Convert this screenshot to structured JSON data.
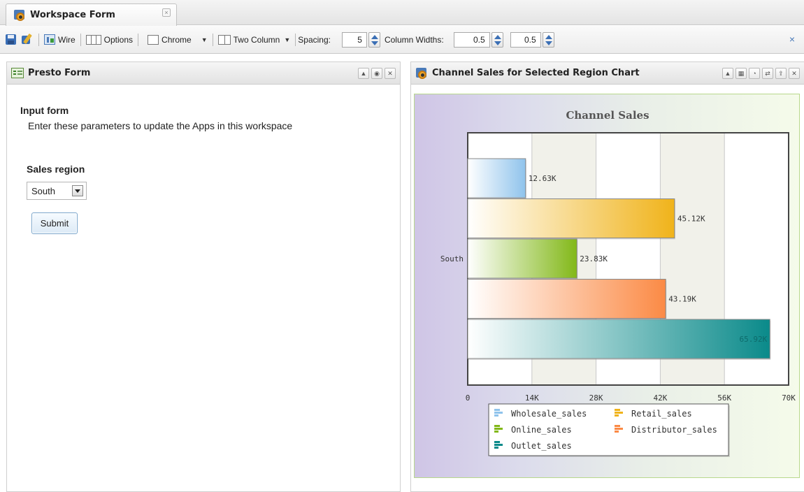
{
  "tab": {
    "title": "Workspace Form",
    "close": "×"
  },
  "toolbar": {
    "wire": "Wire",
    "options": "Options",
    "chrome": "Chrome",
    "layout": "Two Column",
    "spacing_label": "Spacing:",
    "spacing_value": "5",
    "column_widths_label": "Column Widths:",
    "col1_width": "0.5",
    "col2_width": "0.5",
    "close": "×"
  },
  "left_panel": {
    "title": "Presto Form",
    "form_title": "Input form",
    "form_description": "Enter these parameters to update the Apps in this workspace",
    "region_label": "Sales region",
    "region_value": "South",
    "submit": "Submit"
  },
  "right_panel": {
    "title": "Channel Sales for Selected Region Chart"
  },
  "chart_data": {
    "type": "bar",
    "orientation": "horizontal",
    "title": "Channel Sales",
    "categories": [
      "South"
    ],
    "xlim": [
      0,
      70000
    ],
    "x_ticks": [
      "0",
      "14K",
      "28K",
      "42K",
      "56K",
      "70K"
    ],
    "series": [
      {
        "name": "Wholesale_sales",
        "values": [
          12630
        ],
        "label": "12.63K",
        "color": "#8fc3ec"
      },
      {
        "name": "Retail_sales",
        "values": [
          45120
        ],
        "label": "45.12K",
        "color": "#f0b31a"
      },
      {
        "name": "Online_sales",
        "values": [
          23830
        ],
        "label": "23.83K",
        "color": "#82b818"
      },
      {
        "name": "Distributor_sales",
        "values": [
          43190
        ],
        "label": "43.19K",
        "color": "#fb8a45"
      },
      {
        "name": "Outlet_sales",
        "values": [
          65920
        ],
        "label": "65.92K",
        "color": "#0a8a8a"
      }
    ],
    "grid": true,
    "legend": "bottom"
  }
}
